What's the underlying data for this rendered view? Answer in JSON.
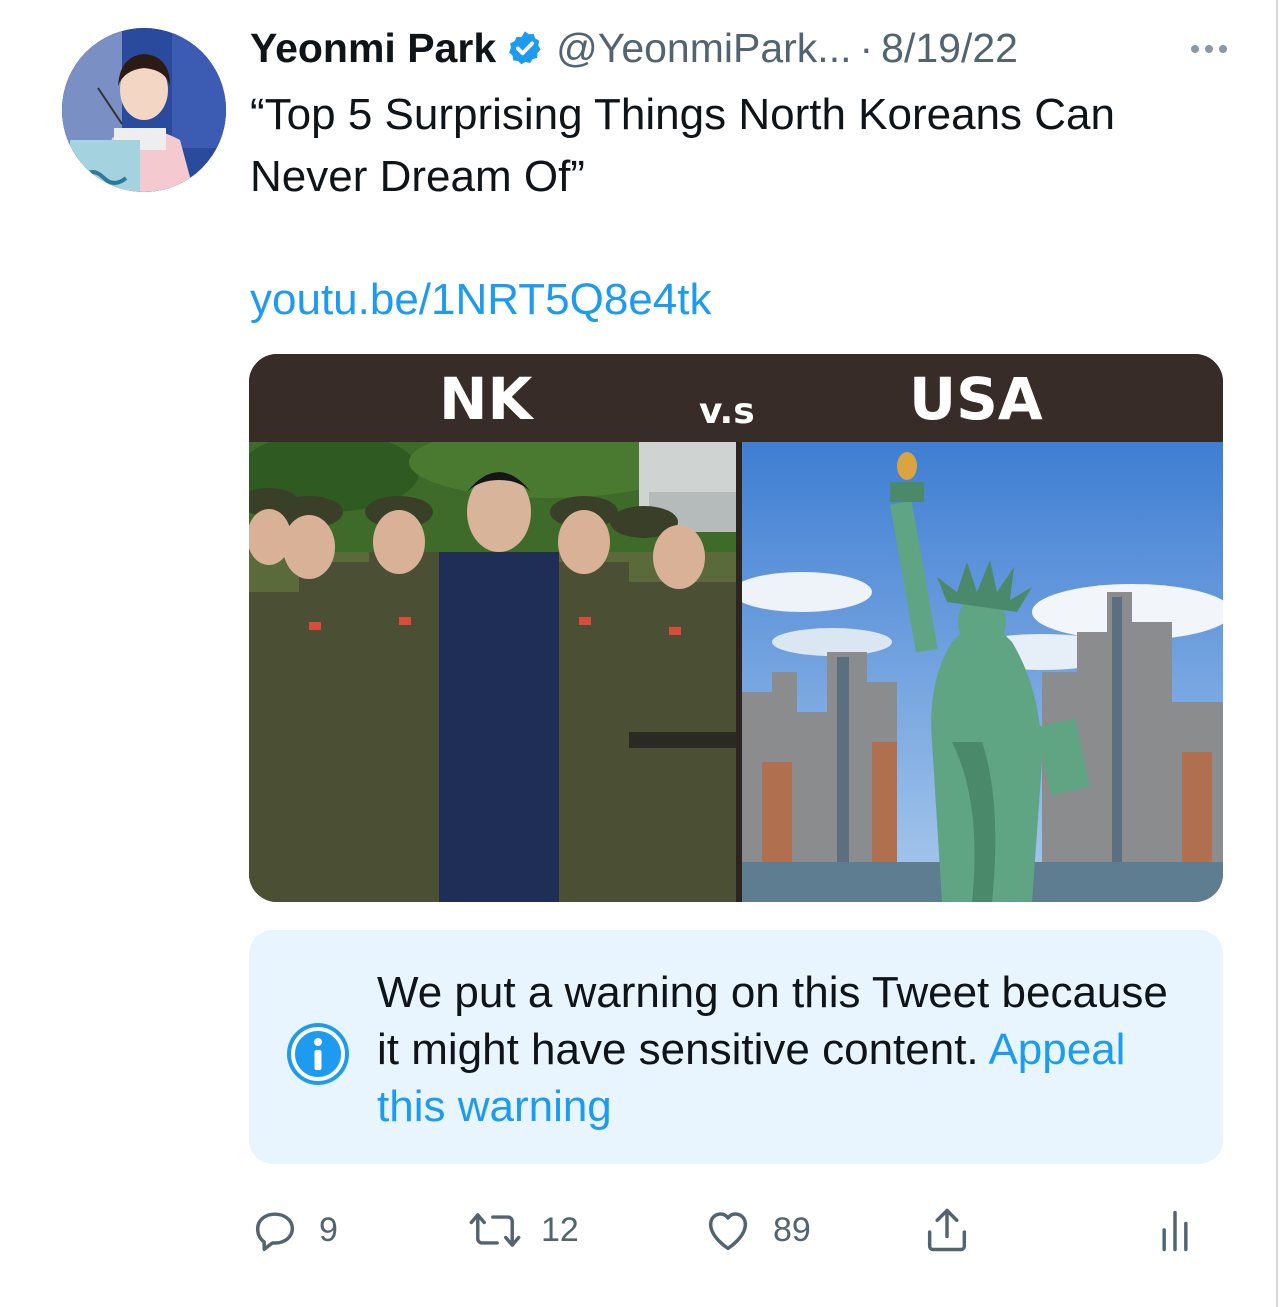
{
  "tweet": {
    "display_name": "Yeonmi Park",
    "handle": "@YeonmiPark...",
    "separator": "·",
    "date": "8/19/22",
    "text": "“Top 5 Surprising Things North Koreans Can\nNever Dream Of”",
    "link": "youtu.be/1NRT5Q8e4tk"
  },
  "media": {
    "label_left": "NK",
    "label_middle": "v.s",
    "label_right": "USA"
  },
  "notice": {
    "text": "We put a warning on this Tweet because it might have sensitive content.",
    "link": "Appeal this warning"
  },
  "actions": {
    "replies": "9",
    "retweets": "12",
    "likes": "89"
  },
  "icons": {
    "verified": "verified-badge-icon",
    "more": "more-options-icon",
    "info": "info-icon",
    "reply": "reply-icon",
    "retweet": "retweet-icon",
    "like": "heart-icon",
    "share": "share-icon",
    "analytics": "analytics-icon"
  },
  "colors": {
    "link_blue": "#1d9bf0",
    "secondary_text": "#536471",
    "notice_background": "#e8f5fe"
  }
}
